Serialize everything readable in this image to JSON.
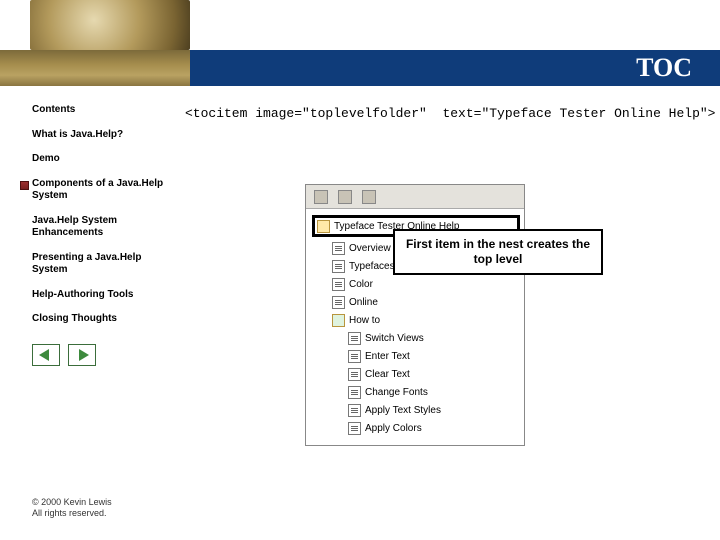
{
  "header": {
    "title": "TOC"
  },
  "sidebar": {
    "items": [
      {
        "label": "Contents",
        "active": false
      },
      {
        "label": "What is Java.Help?",
        "active": false
      },
      {
        "label": "Demo",
        "active": false
      },
      {
        "label": "Components of a Java.Help System",
        "active": true
      },
      {
        "label": "Java.Help System Enhancements",
        "active": false
      },
      {
        "label": "Presenting a Java.Help System",
        "active": false
      },
      {
        "label": "Help-Authoring Tools",
        "active": false
      },
      {
        "label": "Closing Thoughts",
        "active": false
      }
    ]
  },
  "code_line": "<tocitem image=\"toplevelfolder\"  text=\"Typeface Tester Online Help\">",
  "tree": {
    "top_level": "Typeface Tester Online Help",
    "children": [
      "Overview",
      "Typefaces",
      "Color",
      "Online"
    ],
    "howto": {
      "label": "How to",
      "children": [
        "Switch Views",
        "Enter Text",
        "Clear Text",
        "Change Fonts",
        "Apply Text Styles",
        "Apply Colors"
      ]
    }
  },
  "callout": "First item in the nest creates the top level",
  "footer": {
    "line1": "© 2000 Kevin Lewis",
    "line2": "All rights reserved."
  }
}
